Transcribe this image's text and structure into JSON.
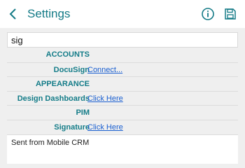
{
  "header": {
    "title": "Settings",
    "back_icon": "chevron-left-icon",
    "info_icon": "info-icon",
    "save_icon": "save-icon",
    "accent_color": "#137a86"
  },
  "search": {
    "value": "sig"
  },
  "sections": [
    {
      "title": "ACCOUNTS",
      "items": [
        {
          "label": "DocuSign",
          "link": "Connect..."
        }
      ]
    },
    {
      "title": "APPEARANCE",
      "items": [
        {
          "label": "Design Dashboards",
          "link": "Click Here"
        }
      ]
    },
    {
      "title": "PIM",
      "items": [
        {
          "label": "Signature",
          "link": "Click Here"
        }
      ]
    }
  ],
  "signature_text": "Sent from Mobile CRM"
}
